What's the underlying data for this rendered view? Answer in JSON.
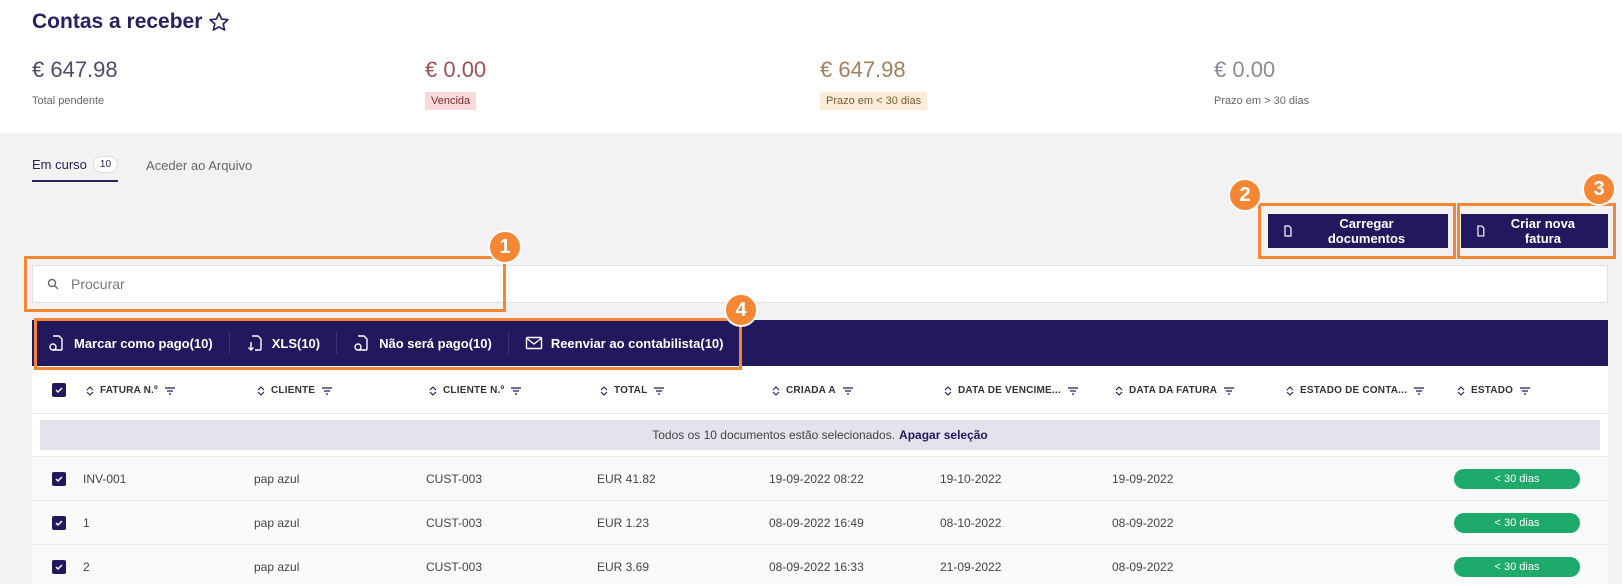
{
  "page": {
    "title": "Contas a receber"
  },
  "kpis": [
    {
      "amount": "€ 647.98",
      "label": "Total pendente"
    },
    {
      "amount": "€ 0.00",
      "label": "Vencida"
    },
    {
      "amount": "€ 647.98",
      "label": "Prazo em < 30 dias"
    },
    {
      "amount": "€ 0.00",
      "label": "Prazo em > 30 dias"
    }
  ],
  "tabs": [
    {
      "label": "Em curso",
      "badge": "10"
    },
    {
      "label": "Aceder ao Arquivo"
    }
  ],
  "buttons": {
    "upload": "Carregar documentos",
    "new_invoice": "Criar nova fatura"
  },
  "search": {
    "placeholder": "Procurar"
  },
  "actions": [
    {
      "label": "Marcar como pago(10)"
    },
    {
      "label": "XLS(10)"
    },
    {
      "label": "Não será pago(10)"
    },
    {
      "label": "Reenviar ao contabilista(10)"
    }
  ],
  "table": {
    "columns": [
      "FATURA N.º",
      "CLIENTE",
      "CLIENTE N.º",
      "TOTAL",
      "CRIADA A",
      "DATA DE VENCIME...",
      "DATA DA FATURA",
      "ESTADO DE CONTA...",
      "ESTADO"
    ],
    "selection_notice": "Todos os 10 documentos estão selecionados.",
    "clear_selection": "Apagar seleção",
    "rows": [
      {
        "invoice": "INV-001",
        "client": "pap azul",
        "client_no": "CUST-003",
        "total": "EUR 41.82",
        "created": "19-09-2022 08:22",
        "due": "19-10-2022",
        "invoice_date": "19-09-2022",
        "status": "< 30 dias"
      },
      {
        "invoice": "1",
        "client": "pap azul",
        "client_no": "CUST-003",
        "total": "EUR 1.23",
        "created": "08-09-2022 16:49",
        "due": "08-10-2022",
        "invoice_date": "08-09-2022",
        "status": "< 30 dias"
      },
      {
        "invoice": "2",
        "client": "pap azul",
        "client_no": "CUST-003",
        "total": "EUR 3.69",
        "created": "08-09-2022 16:33",
        "due": "21-09-2022",
        "invoice_date": "08-09-2022",
        "status": "< 30 dias"
      }
    ]
  },
  "annotations": [
    "1",
    "2",
    "3",
    "4"
  ],
  "colors": {
    "primary": "#22185e",
    "accent": "#f58634",
    "status_ok": "#1eaa6a"
  }
}
